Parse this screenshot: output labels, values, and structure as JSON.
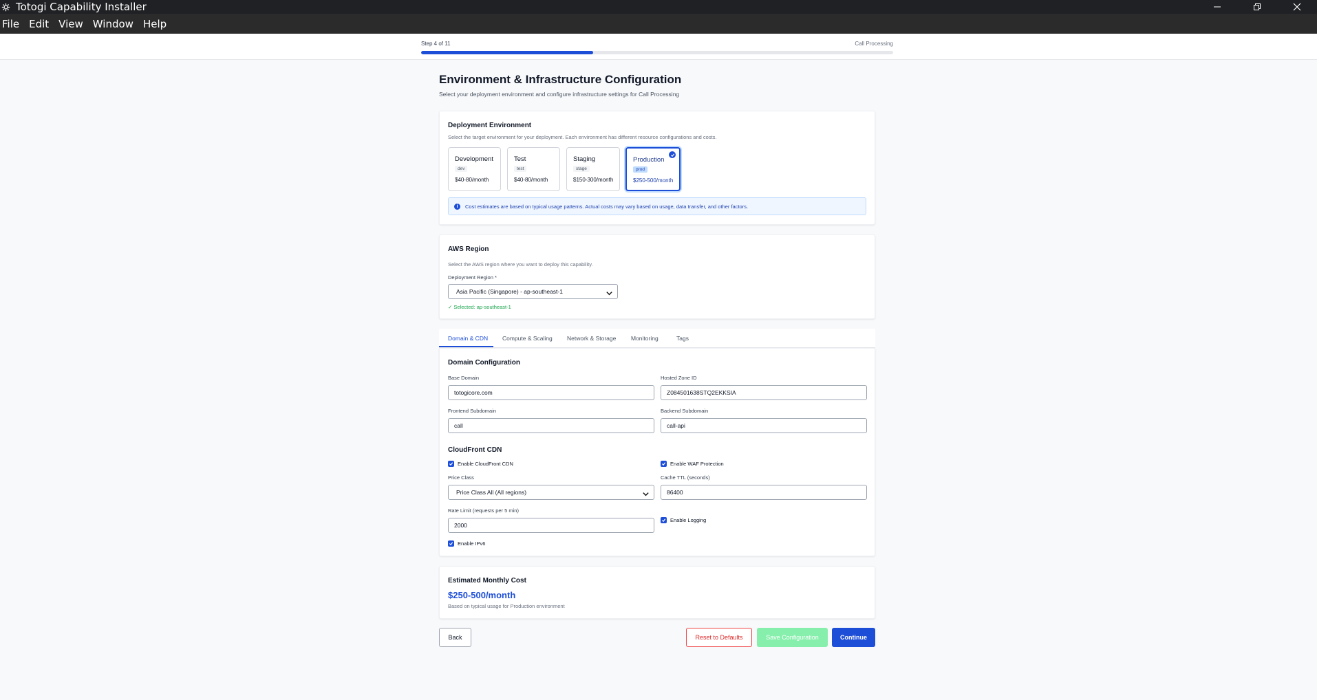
{
  "window": {
    "title": "Totogi Capability Installer",
    "controls": [
      "minimize-icon",
      "restore-icon",
      "close-icon"
    ]
  },
  "menu": [
    "File",
    "Edit",
    "View",
    "Window",
    "Help"
  ],
  "progress": {
    "step_text": "Step 4 of 11",
    "section_name": "Call Processing",
    "fraction": 0.364
  },
  "page": {
    "title": "Environment & Infrastructure Configuration",
    "subtitle": "Select your deployment environment and configure infrastructure settings for Call Processing"
  },
  "environment": {
    "title": "Deployment Environment",
    "description": "Select the target environment for your deployment. Each environment has different resource configurations and costs.",
    "options": [
      {
        "name": "Development",
        "tag": "dev",
        "cost": "$40-80/month",
        "selected": false
      },
      {
        "name": "Test",
        "tag": "test",
        "cost": "$40-80/month",
        "selected": false
      },
      {
        "name": "Staging",
        "tag": "stage",
        "cost": "$150-300/month",
        "selected": false
      },
      {
        "name": "Production",
        "tag": "prod",
        "cost": "$250-500/month",
        "selected": true
      }
    ],
    "info": "Cost estimates are based on typical usage patterns. Actual costs may vary based on usage, data transfer, and other factors."
  },
  "region": {
    "title": "AWS Region",
    "description": "Select the AWS region where you want to deploy this capability.",
    "label": "Deployment Region *",
    "value": "Asia Pacific (Singapore) - ap-southeast-1",
    "selected_note": "✓ Selected: ap-southeast-1"
  },
  "tabs": [
    "Domain & CDN",
    "Compute & Scaling",
    "Network & Storage",
    "Monitoring",
    "Tags"
  ],
  "domain": {
    "section_title": "Domain Configuration",
    "base_domain_label": "Base Domain",
    "base_domain_value": "totogicore.com",
    "hosted_zone_label": "Hosted Zone ID",
    "hosted_zone_value": "Z084501638STQ2EKKSIA",
    "frontend_label": "Frontend Subdomain",
    "frontend_value": "call",
    "backend_label": "Backend Subdomain",
    "backend_value": "call-api"
  },
  "cdn": {
    "section_title": "CloudFront CDN",
    "enable_cdn": "Enable CloudFront CDN",
    "enable_waf": "Enable WAF Protection",
    "price_class_label": "Price Class",
    "price_class_value": "Price Class All (All regions)",
    "cache_ttl_label": "Cache TTL (seconds)",
    "cache_ttl_value": "86400",
    "rate_limit_label": "Rate Limit (requests per 5 min)",
    "rate_limit_value": "2000",
    "enable_logging": "Enable Logging",
    "enable_ipv6": "Enable IPv6"
  },
  "cost": {
    "title": "Estimated Monthly Cost",
    "amount": "$250-500/month",
    "note": "Based on typical usage for Production environment"
  },
  "buttons": {
    "back": "Back",
    "reset": "Reset to Defaults",
    "save": "Save Configuration",
    "continue": "Continue"
  },
  "colors": {
    "accent": "#1d4ed8",
    "save_button": "#86efac",
    "reset_border": "#ef4444",
    "success_text": "#16a34a"
  }
}
